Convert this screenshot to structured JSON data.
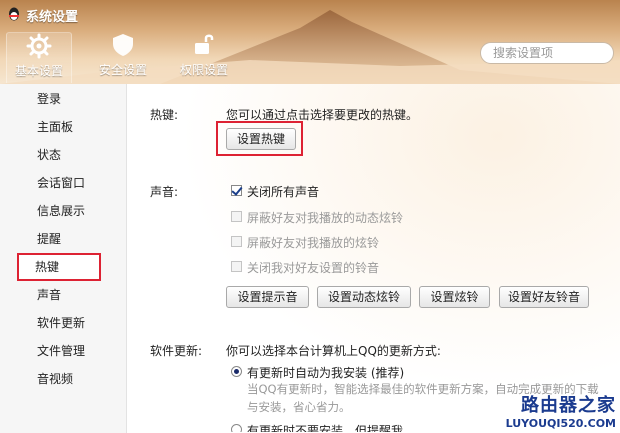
{
  "window": {
    "title": "系统设置"
  },
  "tabs": [
    {
      "label": "基本设置",
      "icon": "gear-icon"
    },
    {
      "label": "安全设置",
      "icon": "shield-icon"
    },
    {
      "label": "权限设置",
      "icon": "lock-icon"
    }
  ],
  "search": {
    "placeholder": "搜索设置项"
  },
  "sidebar": {
    "items": [
      {
        "label": "登录"
      },
      {
        "label": "主面板"
      },
      {
        "label": "状态"
      },
      {
        "label": "会话窗口"
      },
      {
        "label": "信息展示"
      },
      {
        "label": "提醒"
      },
      {
        "label": "热键"
      },
      {
        "label": "声音"
      },
      {
        "label": "软件更新"
      },
      {
        "label": "文件管理"
      },
      {
        "label": "音视频"
      }
    ],
    "selected": "热键"
  },
  "hotkey": {
    "section_label": "热键:",
    "description": "您可以通过点击选择要更改的热键。",
    "button": "设置热键"
  },
  "sound": {
    "section_label": "声音:",
    "checkboxes": [
      {
        "label": "关闭所有声音",
        "checked": true,
        "enabled": true
      },
      {
        "label": "屏蔽好友对我播放的动态炫铃",
        "checked": false,
        "enabled": false
      },
      {
        "label": "屏蔽好友对我播放的炫铃",
        "checked": false,
        "enabled": false
      },
      {
        "label": "关闭我对好友设置的铃音",
        "checked": false,
        "enabled": false
      }
    ],
    "buttons": [
      "设置提示音",
      "设置动态炫铃",
      "设置炫铃",
      "设置好友铃音"
    ]
  },
  "update": {
    "section_label": "软件更新:",
    "description": "你可以选择本台计算机上QQ的更新方式:",
    "options": [
      {
        "label": "有更新时自动为我安装 (推荐)",
        "selected": true,
        "detail_line1": "当QQ有更新时，智能选择最佳的软件更新方案，自动完成更新的下载",
        "detail_line2": "与安装，省心省力。"
      },
      {
        "label": "有更新时不要安装，但提醒我",
        "selected": false
      }
    ]
  },
  "watermark": {
    "main": "路由器之家",
    "sub": "LUYOUQI520.COM"
  }
}
